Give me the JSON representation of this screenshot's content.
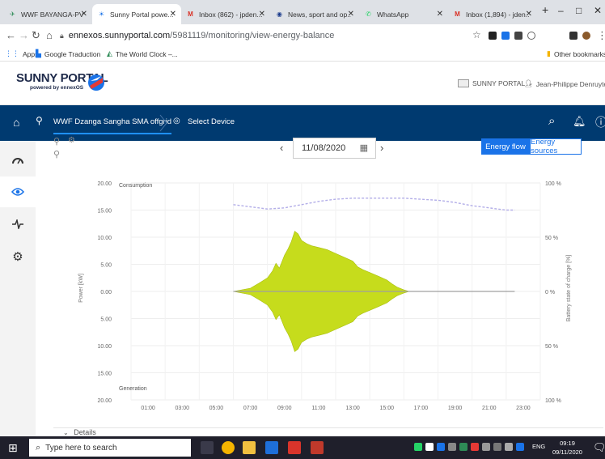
{
  "tabs": [
    {
      "label": "WWF BAYANGA-PV ...",
      "fav_color": "#2e8b57",
      "fav_glyph": "✈"
    },
    {
      "label": "Sunny Portal powe...",
      "fav_color": "#1a73e8",
      "fav_glyph": "☀"
    },
    {
      "label": "Inbox (862) - jpden...",
      "fav_color": "#d93025",
      "fav_glyph": "M"
    },
    {
      "label": "News, sport and op...",
      "fav_color": "#1a3b8c",
      "fav_glyph": "◉"
    },
    {
      "label": "WhatsApp",
      "fav_color": "#25d366",
      "fav_glyph": "✆"
    },
    {
      "label": "Inbox (1,894) - jden...",
      "fav_color": "#d93025",
      "fav_glyph": "M"
    }
  ],
  "new_tab_glyph": "+",
  "window_buttons": {
    "minimize": "–",
    "restore": "□",
    "close": "✕"
  },
  "address": {
    "host": "ennexos.sunnyportal.com",
    "path": "/5981119/monitoring/view-energy-balance"
  },
  "bookmarks": {
    "apps": "Apps",
    "items": [
      "Google Traduction",
      "The World Clock –..."
    ],
    "other": "Other bookmarks"
  },
  "header": {
    "logo_title": "SUNNY PORTAL",
    "logo_sub": "powered by ennexOS",
    "portal_menu": "SUNNY PORTAL",
    "user_name": "Jean-Philippe Denruyter"
  },
  "nav": {
    "plant_name": "WWF Dzanga Sangha SMA offgrid",
    "select_device": "Select Device"
  },
  "date": {
    "value": "11/08/2020"
  },
  "view_buttons": {
    "energy_flow": "Energy flow",
    "energy_sources": "Energy sources"
  },
  "details_label": "Details",
  "taskbar": {
    "search_placeholder": "Type here to search",
    "time": "09:19",
    "date": "09/11/2020",
    "lang": "ENG"
  },
  "chart_data": {
    "type": "area",
    "left_axis": {
      "label": "Power [kW]",
      "ticks": [
        "20.00",
        "15.00",
        "10.00",
        "5.00",
        "0.00",
        "5.00",
        "10.00",
        "15.00",
        "20.00"
      ],
      "range": [
        -20,
        20
      ]
    },
    "right_axis": {
      "label": "Battery state of charge [%]",
      "ticks": [
        "100 %",
        "50 %",
        "0 %",
        "50 %",
        "100 %"
      ]
    },
    "x_ticks": [
      "01:00",
      "03:00",
      "05:00",
      "07:00",
      "09:00",
      "11:00",
      "13:00",
      "15:00",
      "17:00",
      "19:00",
      "21:00",
      "23:00"
    ],
    "annotations": {
      "top": "Consumption",
      "bottom": "Generation"
    },
    "colors": {
      "area": "#c6dc1c",
      "area_stroke": "#a9bf10",
      "soc": "#b3aee8",
      "baseline": "#a0a0a0"
    },
    "series": [
      {
        "kind": "power_area",
        "x_hours": [
          6.0,
          7.0,
          7.5,
          8.0,
          8.3,
          8.5,
          8.7,
          9.0,
          9.2,
          9.4,
          9.6,
          9.8,
          10.0,
          10.3,
          10.6,
          11.0,
          11.5,
          12.0,
          12.5,
          13.0,
          13.3,
          13.6,
          14.0,
          14.5,
          15.0,
          15.3,
          15.6,
          16.0,
          16.3
        ],
        "upper_kw": [
          0,
          0.6,
          1.5,
          2.5,
          3.8,
          5.2,
          4.3,
          6.7,
          7.8,
          9.2,
          11.1,
          10.6,
          9.4,
          8.8,
          8.4,
          8.1,
          7.7,
          7.0,
          6.3,
          5.6,
          4.5,
          4.0,
          3.5,
          2.8,
          2.1,
          1.4,
          0.8,
          0.3,
          0
        ],
        "lower_kw": [
          0,
          -0.6,
          -1.5,
          -2.5,
          -3.8,
          -5.2,
          -4.3,
          -6.7,
          -7.8,
          -9.2,
          -11.1,
          -10.6,
          -9.4,
          -8.8,
          -8.4,
          -8.1,
          -7.7,
          -7.0,
          -6.3,
          -5.6,
          -4.5,
          -4.0,
          -3.5,
          -2.8,
          -2.1,
          -1.4,
          -0.8,
          -0.3,
          0
        ]
      },
      {
        "kind": "battery_soc",
        "x_hours": [
          6.0,
          7.0,
          8.0,
          9.0,
          10.0,
          11.0,
          12.0,
          13.0,
          14.0,
          15.0,
          16.0,
          17.0,
          18.0,
          19.0,
          20.0,
          21.0,
          22.0,
          22.5
        ],
        "soc_pct": [
          80,
          78,
          76,
          77,
          80,
          83,
          85,
          86,
          86,
          86,
          86,
          85,
          84,
          82,
          79,
          77,
          75,
          75
        ]
      }
    ],
    "baseline_end_hour": 22.5,
    "grid": true
  }
}
